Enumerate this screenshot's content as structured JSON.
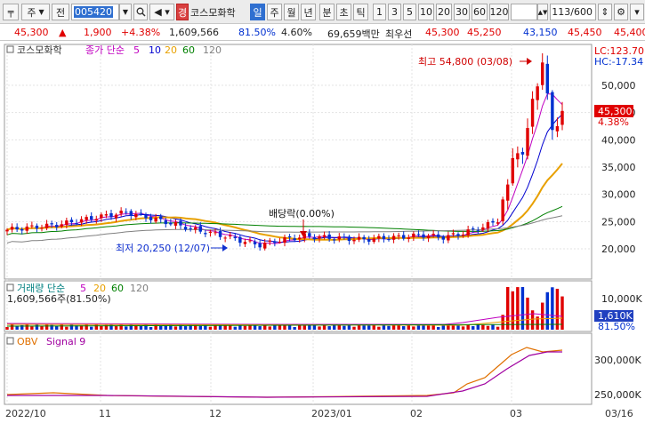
{
  "toolbar": {
    "code_prefix": "주",
    "code_type": "전",
    "stock_code": "005420",
    "badge": "경",
    "stock_name": "코스모화학",
    "periods": [
      "일",
      "주",
      "월",
      "년",
      "분",
      "초",
      "틱"
    ],
    "selected_period": "일",
    "intervals": [
      "1",
      "3",
      "5",
      "10",
      "20",
      "30",
      "60",
      "120"
    ],
    "count": "113/600"
  },
  "quote": {
    "price": "45,300",
    "change_arrow": "▲",
    "change": "1,900",
    "change_pct": "+4.38%",
    "volume": "1,609,566",
    "volume_ratio": "81.50%",
    "turnover_ratio": "4.60%",
    "trade_amount": "69,659백만",
    "best_label": "최우선",
    "ask": "45,300",
    "bid": "45,250",
    "low": "43,150",
    "high": "45,450",
    "prev_label": "",
    "prev": "45,400"
  },
  "price_panel": {
    "stock_label": "코스모화학",
    "legend_prefix": "종가 단순",
    "ma_periods": [
      "5",
      "10",
      "20",
      "60",
      "120"
    ],
    "ma_colors": [
      "#c000c0",
      "#0000d0",
      "#e8a000",
      "#008000",
      "#808080"
    ],
    "lc": "LC:123.70",
    "hc": "HC:-17.34",
    "current_price": "45,300",
    "current_pct": "4.38%",
    "annotation_high": "최고 54,800 (03/08)",
    "annotation_low": "최저 20,250 (12/07)",
    "annotation_dividend": "배당락(0.00%)",
    "y_ticks": [
      "50,000",
      "45,000",
      "40,000",
      "35,000",
      "30,000",
      "25,000",
      "20,000"
    ]
  },
  "volume_panel": {
    "legend_prefix": "거래량 단순",
    "ma_periods": [
      "5",
      "20",
      "60",
      "120"
    ],
    "ma_colors": [
      "#c000c0",
      "#e8a000",
      "#008000",
      "#808080"
    ],
    "value_text": "1,609,566주(81.50%)",
    "y_ticks": [
      "10,000K"
    ],
    "current_volume": "1,610K",
    "current_pct": "81.50%"
  },
  "obv_panel": {
    "label": "OBV",
    "signal_label": "Signal 9",
    "y_ticks": [
      "300,000K",
      "250,000K"
    ]
  },
  "x_axis": {
    "labels": [
      "2022/10",
      "11",
      "12",
      "2023/01",
      "02",
      "03",
      "03/16"
    ]
  },
  "colors": {
    "up": "#e00000",
    "down": "#0030d0",
    "selected": "#2f6fd0"
  }
}
